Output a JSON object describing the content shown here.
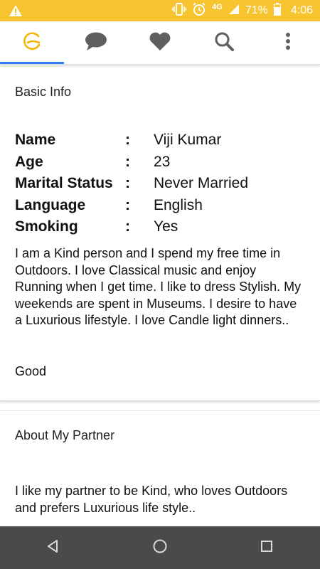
{
  "status_bar": {
    "network": "4G",
    "battery": "71%",
    "time": "4:06",
    "bg_color": "#F7C42F"
  },
  "tabs": [
    {
      "icon": "app-logo-icon",
      "active": true
    },
    {
      "icon": "chat-bubble-icon",
      "active": false
    },
    {
      "icon": "heart-icon",
      "active": false
    },
    {
      "icon": "search-icon",
      "active": false
    },
    {
      "icon": "overflow-menu-icon",
      "active": false
    }
  ],
  "basic_info": {
    "title": "Basic Info",
    "rows": [
      {
        "label": "Name",
        "sep": ":",
        "value": "Viji Kumar"
      },
      {
        "label": "Age",
        "sep": ":",
        "value": "23"
      },
      {
        "label": "Marital Status",
        "sep": ":",
        "value": "Never Married"
      },
      {
        "label": "Language",
        "sep": ":",
        "value": "English"
      },
      {
        "label": "Smoking",
        "sep": ":",
        "value": "Yes"
      }
    ],
    "about": "I am a Kind person and I spend my free time in Outdoors. I love Classical music and enjoy Running when I get time. I like to dress Stylish. My weekends are spent in Museums. I desire to have a Luxurious lifestyle. I love Candle light dinners..",
    "extra": "Good"
  },
  "partner": {
    "title": "About My Partner",
    "text": "I like my partner to be Kind, who loves Outdoors and prefers Luxurious life style.."
  },
  "nav": [
    {
      "icon": "back-triangle-icon"
    },
    {
      "icon": "home-circle-icon"
    },
    {
      "icon": "recents-square-icon"
    }
  ],
  "colors": {
    "accent": "#2E7CF6",
    "logo": "#F2B705",
    "tab_icon": "#5f5f5f",
    "nav_bg": "#4A4A4A"
  }
}
